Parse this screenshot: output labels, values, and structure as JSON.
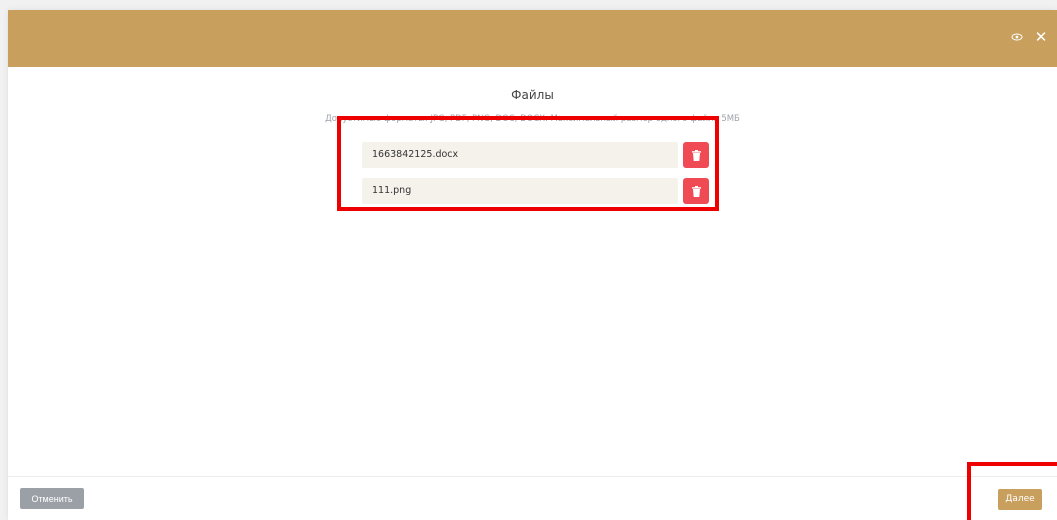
{
  "header": {
    "background_color": "#c99f5e",
    "icons": [
      "eye-icon",
      "close-icon"
    ],
    "close_glyph": "✕"
  },
  "content": {
    "title": "Файлы",
    "subtitle": "Допустимые форматы: JPG, PDF, PNG, DOC, DOCX. Максимальный размер одного файла 5МБ"
  },
  "files": [
    {
      "name": "1663842125.docx",
      "delete_icon": "trash-icon"
    },
    {
      "name": "111.png",
      "delete_icon": "trash-icon"
    }
  ],
  "footer": {
    "cancel_label": "Отменить",
    "next_label": "Далее"
  },
  "colors": {
    "accent": "#c99f5e",
    "delete": "#f04b55",
    "cancel": "#9aa0a6",
    "highlight": "#ee0000"
  }
}
